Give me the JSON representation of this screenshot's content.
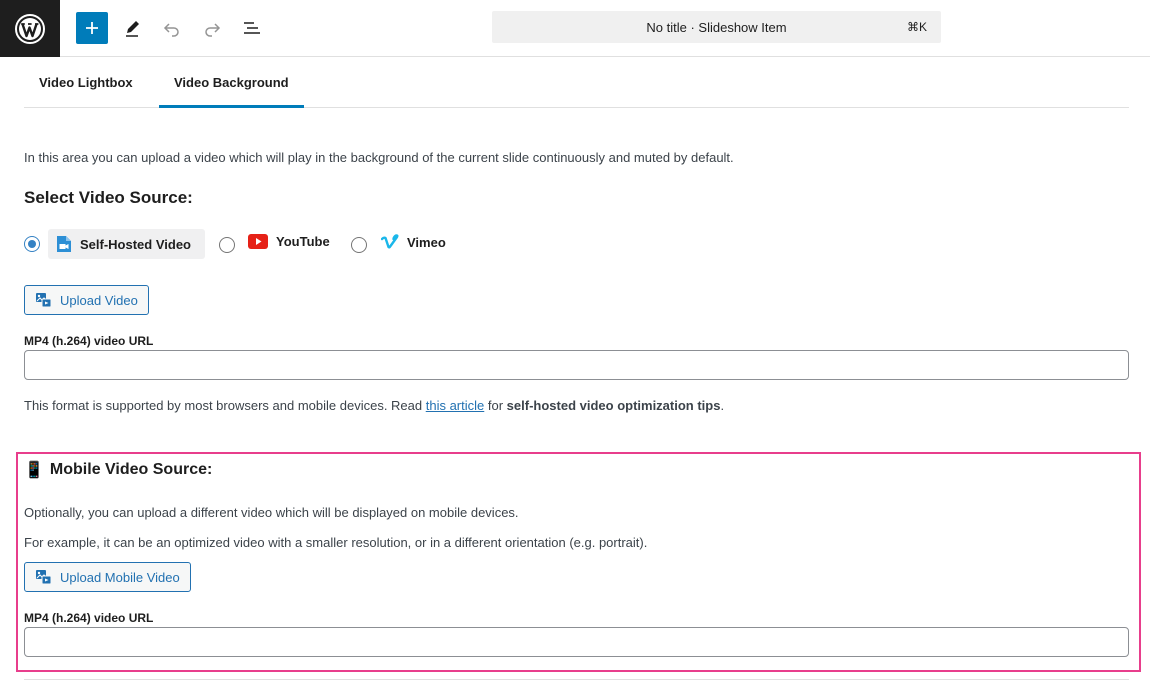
{
  "toolbar": {
    "command_title": "No title · Slideshow Item",
    "shortcut": "⌘K",
    "icons": [
      "wordpress-logo",
      "plus-icon",
      "pencil-icon",
      "undo-icon",
      "redo-icon",
      "list-view-icon"
    ]
  },
  "tabs": [
    {
      "label": "Video Lightbox",
      "active": false
    },
    {
      "label": "Video Background",
      "active": true
    }
  ],
  "main": {
    "intro": "In this area you can upload a video which will play in the background of the current slide continuously and muted by default.",
    "select_heading": "Select Video Source:",
    "sources": [
      {
        "label": "Self-Hosted Video",
        "checked": true,
        "icon": "video-file-icon"
      },
      {
        "label": "YouTube",
        "checked": false,
        "icon": "youtube-icon"
      },
      {
        "label": "Vimeo",
        "checked": false,
        "icon": "vimeo-icon"
      }
    ],
    "upload_label": "Upload Video",
    "url_label": "MP4 (h.264) video URL",
    "url_value": "",
    "support_pre": "This format is supported by most browsers and mobile devices. Read ",
    "support_link": "this article",
    "support_mid": " for ",
    "support_bold": "self-hosted video optimization tips",
    "support_end": "."
  },
  "mobile": {
    "emoji": "📱",
    "heading": "Mobile Video Source:",
    "line1": "Optionally, you can upload a different video which will be displayed on mobile devices.",
    "line2": "For example, it can be an optimized video with a smaller resolution, or in a different orientation (e.g. portrait).",
    "upload_label": "Upload Mobile Video",
    "url_label": "MP4 (h.264) video URL",
    "url_value": ""
  },
  "colors": {
    "accent": "#007cba",
    "highlight_border": "#e83e8c",
    "youtube_red": "#e62117",
    "vimeo_blue": "#1ab7ea"
  }
}
